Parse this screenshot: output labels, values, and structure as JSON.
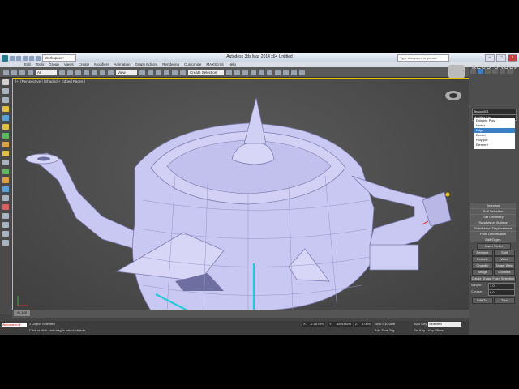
{
  "title_bar": {
    "workspace": "Workspace: Default",
    "title": "Autodesk 3ds Max  2014 x64     Untitled",
    "search_placeholder": "Type a keyword or phrase",
    "minimize": "–",
    "maximize": "□",
    "close": "×"
  },
  "menubar": {
    "items": [
      "Edit",
      "Tools",
      "Group",
      "Views",
      "Create",
      "Modifiers",
      "Animation",
      "Graph Editors",
      "Rendering",
      "Customize",
      "MAXScript",
      "Help"
    ]
  },
  "toolbar": {
    "selection_filter": "All",
    "view_dropdown": "View",
    "named_selection": "Create Selection Se"
  },
  "viewport": {
    "label": "[+] [Perspective ] [Shaded + Edged Faces ]"
  },
  "logo": {
    "brand": "RECO GROUP"
  },
  "command_panel": {
    "object_name": "Teapot001",
    "modifier_list": "Modifier List",
    "stack": [
      "Editable Poly",
      "Vertex",
      "Edge",
      "Border",
      "Polygon",
      "Element"
    ],
    "selected_stack_index": 2,
    "rollouts": [
      "Selection",
      "Soft Selection",
      "Edit Geometry",
      "Subdivision Surface",
      "Subdivision Displacement",
      "Paint Deformation",
      "Edit Edges"
    ],
    "insert_vertex": "Insert Vertex",
    "remove": "Remove",
    "split": "Split",
    "extrude": "Extrude",
    "weld": "Weld",
    "chamfer": "Chamfer",
    "target_weld": "Target Weld",
    "bridge": "Bridge",
    "connect": "Connect",
    "create_shape": "Create Shape From Selection",
    "weight_label": "Weight:",
    "weight_value": "1.0",
    "crease_label": "Crease:",
    "crease_value": "0.0",
    "edit_tri": "Edit Tri.",
    "turn": "Turn"
  },
  "timeline": {
    "slider": "0 / 100"
  },
  "status": {
    "maxscript": "Welcome to M",
    "selection_info": "1 Object Selected",
    "prompt": "Click or click-and-drag to select objects",
    "x_label": "X:",
    "x_value": "-2.487cm",
    "y_label": "Y:",
    "y_value": "-48.934cm",
    "z_label": "Z:",
    "z_value": "0.0cm",
    "grid": "Grid = 10.0cm",
    "add_time_tag": "Add Time Tag",
    "auto_key": "Auto Key",
    "selected": "Selected",
    "set_key": "Set Key",
    "key_filters": "Key Filters..."
  },
  "colors": {
    "viewport_border": "#e8c200",
    "mesh": "#c9c8f2",
    "selected_edge": "#27c9d8"
  }
}
